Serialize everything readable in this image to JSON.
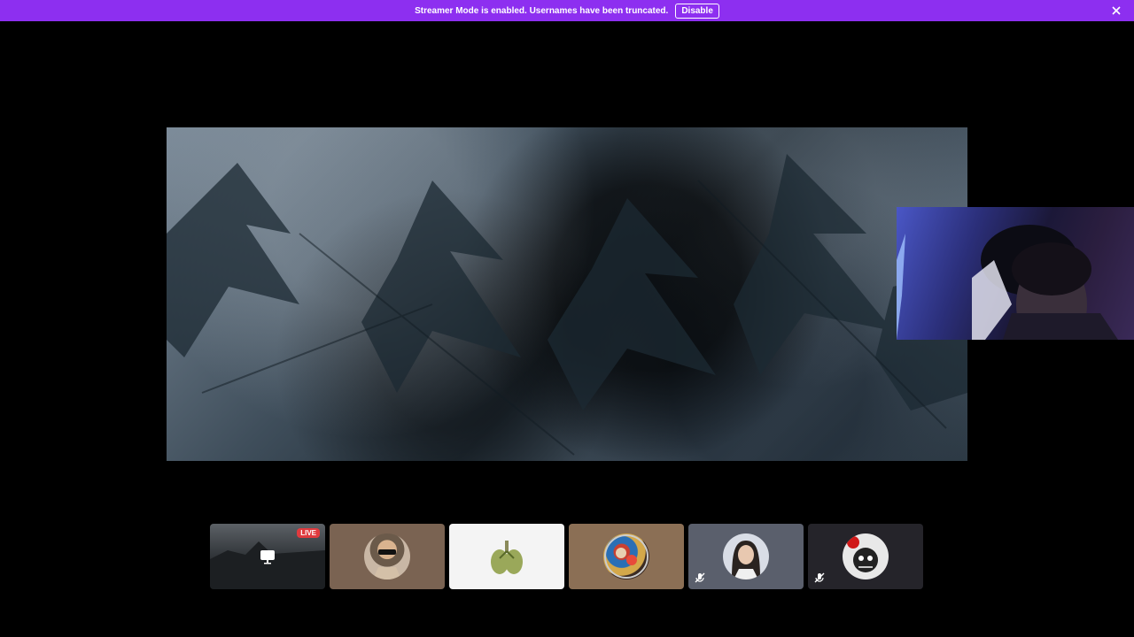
{
  "banner": {
    "message": "Streamer Mode is enabled. Usernames have been truncated.",
    "disable_label": "Disable",
    "close_icon": "close-icon",
    "color": "#8d2ff0"
  },
  "stage": {
    "content": "forest-video-stream"
  },
  "webcam": {
    "content": "webcam-feed"
  },
  "tiles": [
    {
      "name": "participant-stream-tile",
      "badge": "LIVE",
      "icon": "screen-share-icon"
    },
    {
      "name": "participant-tile-2"
    },
    {
      "name": "participant-tile-3"
    },
    {
      "name": "participant-tile-4"
    },
    {
      "name": "participant-tile-5",
      "icon": "mute-icon"
    },
    {
      "name": "participant-tile-6",
      "icon": "mute-icon"
    }
  ]
}
